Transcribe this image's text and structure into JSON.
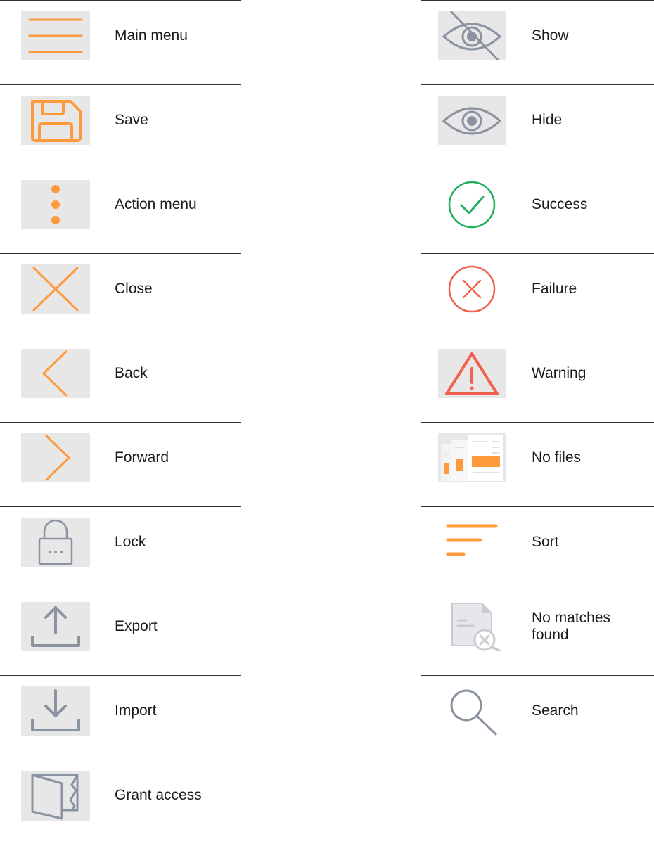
{
  "colors": {
    "accent": "#ff9a3c",
    "neutral": "#8b93a0",
    "success": "#1fae5a",
    "failure": "#f4604e",
    "tile": "#e7e7e7",
    "divider": "#333333"
  },
  "left_items": [
    {
      "label": "Main menu",
      "icon": "hamburger-menu-icon"
    },
    {
      "label": "Save",
      "icon": "floppy-disk-icon"
    },
    {
      "label": "Action menu",
      "icon": "vertical-dots-icon"
    },
    {
      "label": "Close",
      "icon": "close-x-icon"
    },
    {
      "label": "Back",
      "icon": "chevron-left-icon"
    },
    {
      "label": "Forward",
      "icon": "chevron-right-icon"
    },
    {
      "label": "Lock",
      "icon": "lock-icon"
    },
    {
      "label": "Export",
      "icon": "export-upload-icon"
    },
    {
      "label": "Import",
      "icon": "import-download-icon"
    },
    {
      "label": "Grant access",
      "icon": "open-door-icon"
    }
  ],
  "right_items": [
    {
      "label": "Show",
      "icon": "eye-slash-icon"
    },
    {
      "label": "Hide",
      "icon": "eye-icon"
    },
    {
      "label": "Success",
      "icon": "check-circle-icon"
    },
    {
      "label": "Failure",
      "icon": "x-circle-icon"
    },
    {
      "label": "Warning",
      "icon": "warning-triangle-icon"
    },
    {
      "label": "No files",
      "icon": "no-files-icon"
    },
    {
      "label": "Sort",
      "icon": "sort-lines-icon"
    },
    {
      "label": "No matches found",
      "icon": "no-matches-document-icon"
    },
    {
      "label": "Search",
      "icon": "magnifier-search-icon"
    }
  ]
}
